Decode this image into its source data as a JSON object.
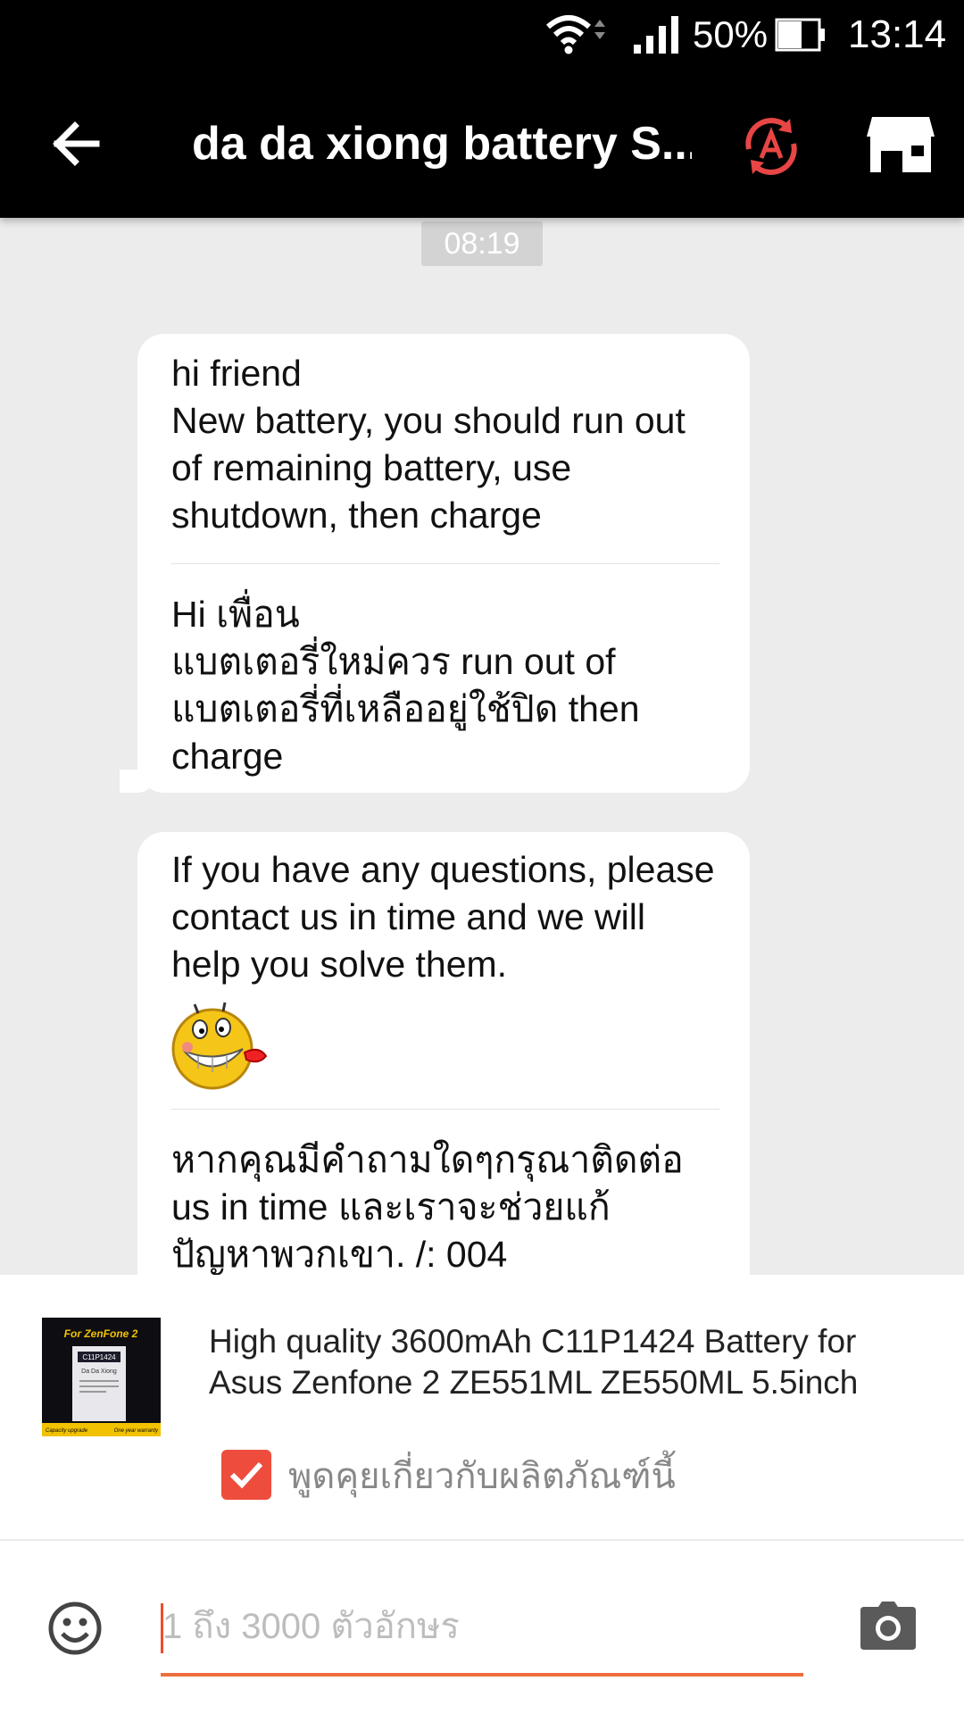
{
  "status_bar": {
    "battery_percent": "50%",
    "time": "13:14",
    "icons": [
      "wifi-icon",
      "signal-icon",
      "battery-icon"
    ]
  },
  "header": {
    "title": "da da xiong battery S...",
    "back_icon": "arrow-left-icon",
    "translate_icon": "translate-icon",
    "store_icon": "store-icon"
  },
  "chat": {
    "timestamp": "08:19",
    "messages": [
      {
        "original": "hi friend\nNew battery, you should run out of remaining battery, use shutdown, then charge",
        "translated": "Hi เพื่อน\nแบตเตอรี่ใหม่ควร run out of แบตเตอรี่ที่เหลืออยู่ใช้ปิด then charge"
      },
      {
        "original": "If you have any questions, please contact us in time and we will help you solve them.",
        "emoji": "grinning-rose-emoji",
        "translated": "หากคุณมีคำถามใดๆกรุณาติดต่อ us in time และเราจะช่วยแก้ ปัญหาพวกเขา. /: 004"
      }
    ]
  },
  "product": {
    "title": "High quality 3600mAh C11P1424 Battery for Asus Zenfone 2 ZE551ML ZE550ML 5.5inch",
    "thumb_heading": "For ZenFone 2",
    "thumb_model": "C11P1424",
    "thumb_brand": "Da Da Xiong",
    "thumb_footer_left": "Capacity upgrade",
    "thumb_footer_right": "One year warranty",
    "checkbox_checked": true,
    "checkbox_label": "พูดคุยเกี่ยวกับผลิตภัณฑ์นี้"
  },
  "input": {
    "placeholder": "1 ถึง 3000 ตัวอักษร",
    "value": "",
    "emoji_icon": "smiley-icon",
    "camera_icon": "camera-icon"
  },
  "colors": {
    "accent": "#ee4d2d",
    "header_bg": "#000000",
    "chat_bg": "#ececec",
    "checkbox": "#ee4d3d",
    "translate_icon": "#e84545"
  }
}
